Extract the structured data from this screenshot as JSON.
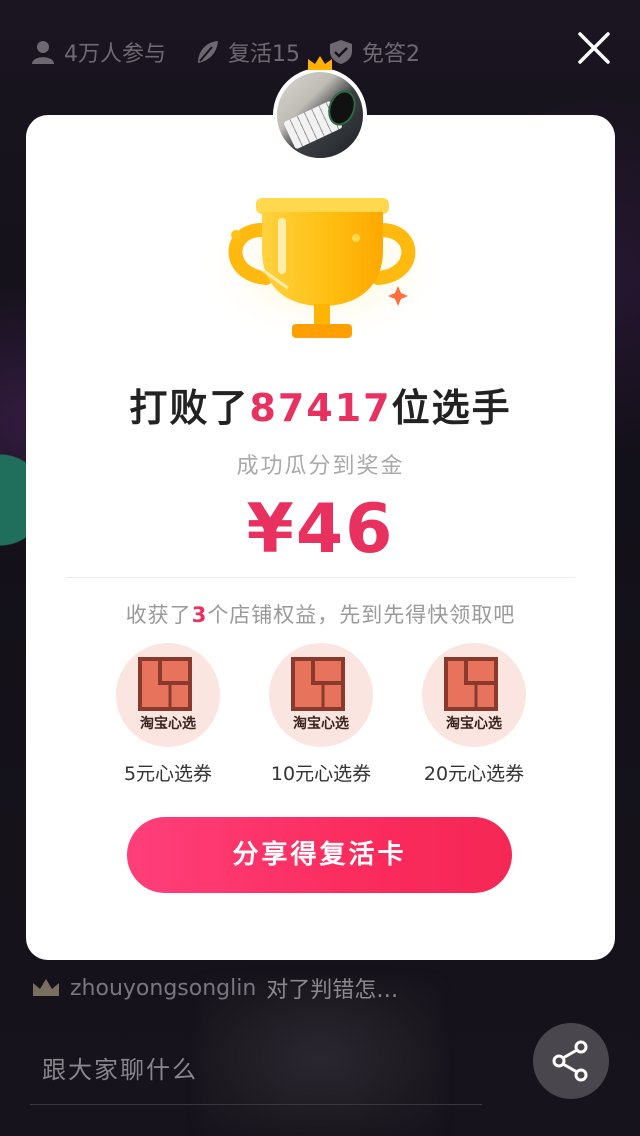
{
  "stats": {
    "participants": "4万人参与",
    "revive": "复活15",
    "skip": "免答2"
  },
  "result": {
    "headline_prefix": "打败了",
    "defeated_count": "87417",
    "headline_suffix": "位选手",
    "subline": "成功瓜分到奖金",
    "prize": "¥46"
  },
  "benefits": {
    "prefix": "收获了",
    "count": "3",
    "suffix": "个店铺权益，先到先得快领取吧",
    "coupons": [
      {
        "brand": "淘宝心选",
        "label": "5元心选券"
      },
      {
        "brand": "淘宝心选",
        "label": "10元心选券"
      },
      {
        "brand": "淘宝心选",
        "label": "20元心选券"
      }
    ]
  },
  "share_button": "分享得复活卡",
  "comment": {
    "username": "zhouyongsonglin",
    "text": "对了判错怎…"
  },
  "chat": {
    "placeholder": "跟大家聊什么"
  },
  "colors": {
    "accent": "#e8315f",
    "button_gradient_start": "#ff3f7b",
    "button_gradient_end": "#f52754",
    "coupon_bg": "#fbe5e0",
    "coupon_logo": "#e8735c",
    "trophy": "#ffc21a"
  },
  "icons": {
    "participants": "user-icon",
    "revive": "leaf-icon",
    "skip": "shield-check-icon",
    "close": "close-icon",
    "crown": "crown-icon",
    "share": "share-icon"
  }
}
